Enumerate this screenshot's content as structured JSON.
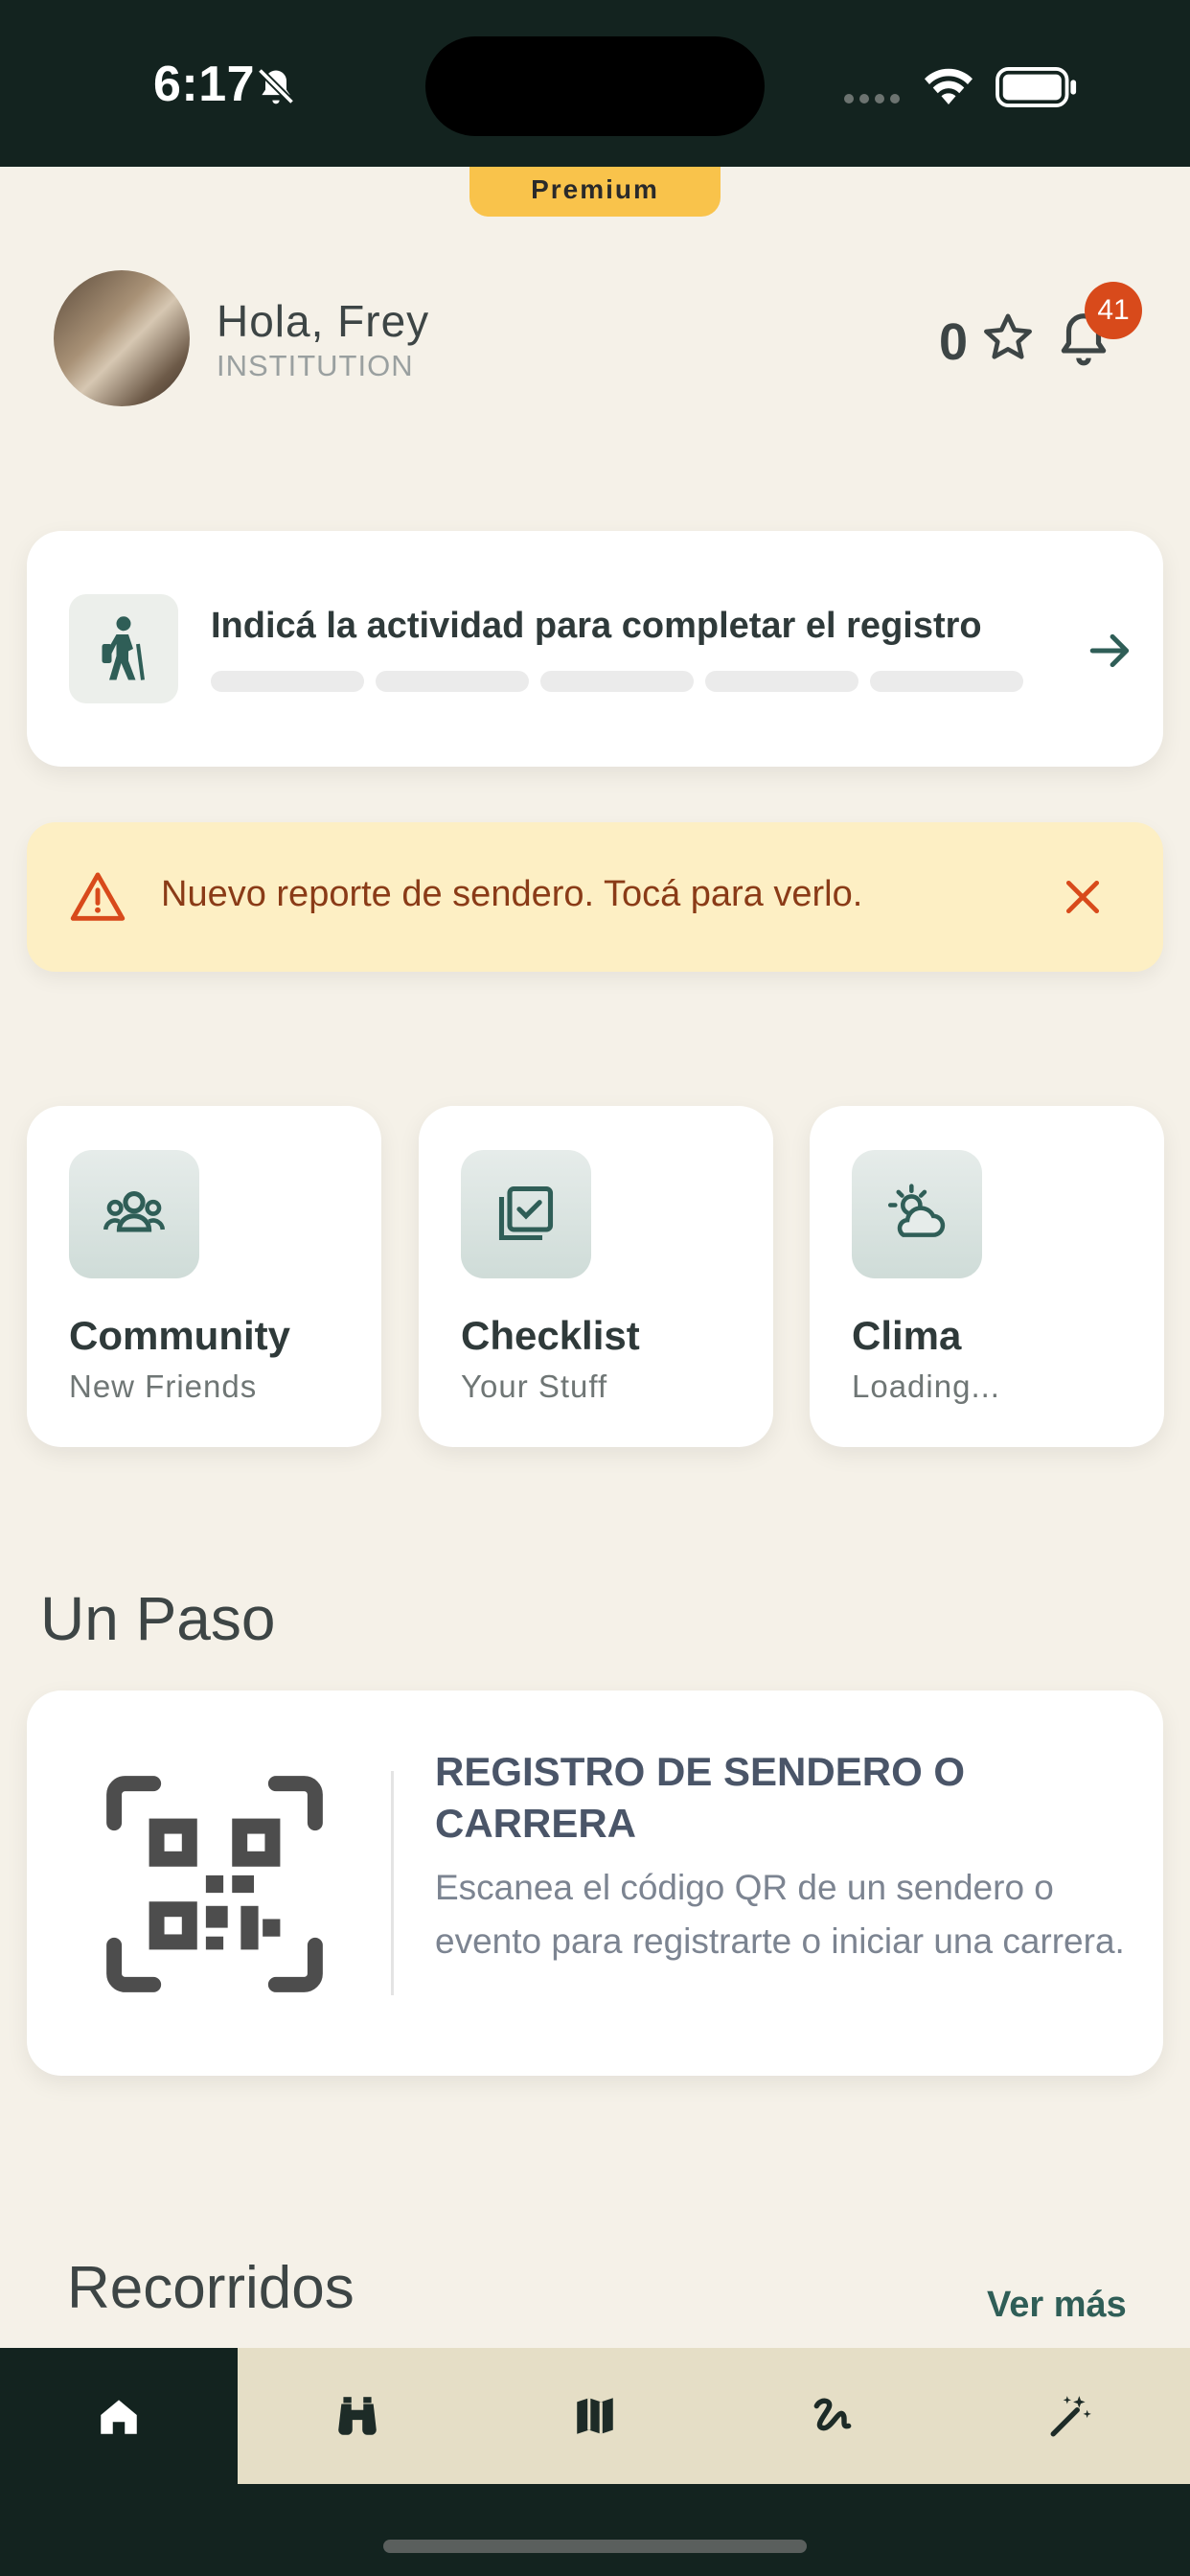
{
  "status_bar": {
    "time": "6:17"
  },
  "premium_label": "Premium",
  "profile": {
    "greeting": "Hola, Frey",
    "role": "INSTITUTION"
  },
  "points": "0",
  "notifications_count": "41",
  "registration": {
    "title": "Indicá la actividad para completar el registro",
    "progress_segments": 5,
    "progress_completed": 0
  },
  "alert": {
    "text": "Nuevo reporte de sendero. Tocá para verlo."
  },
  "tiles": [
    {
      "title": "Community",
      "subtitle": "New Friends",
      "icon": "people-icon"
    },
    {
      "title": "Checklist",
      "subtitle": "Your Stuff",
      "icon": "checklist-icon"
    },
    {
      "title": "Clima",
      "subtitle": "Loading...",
      "icon": "weather-icon"
    }
  ],
  "section_un_paso": "Un Paso",
  "qr_card": {
    "title": "REGISTRO DE SENDERO O CARRERA",
    "description": "Escanea el código QR de un sendero o evento para registrarte o iniciar una carrera."
  },
  "recorridos": {
    "title": "Recorridos",
    "see_more": "Ver más"
  },
  "tabbar": [
    {
      "icon": "home-icon",
      "active": true
    },
    {
      "icon": "binoculars-icon",
      "active": false
    },
    {
      "icon": "map-icon",
      "active": false
    },
    {
      "icon": "route-icon",
      "active": false
    },
    {
      "icon": "magic-wand-icon",
      "active": false
    }
  ],
  "colors": {
    "background": "#f5f1e8",
    "dark": "#13231f",
    "accent": "#2f5e57",
    "premium": "#f9c34b",
    "alert_bg": "#fdefc4",
    "alert_text": "#8a3b17",
    "badge": "#d84a1b"
  }
}
